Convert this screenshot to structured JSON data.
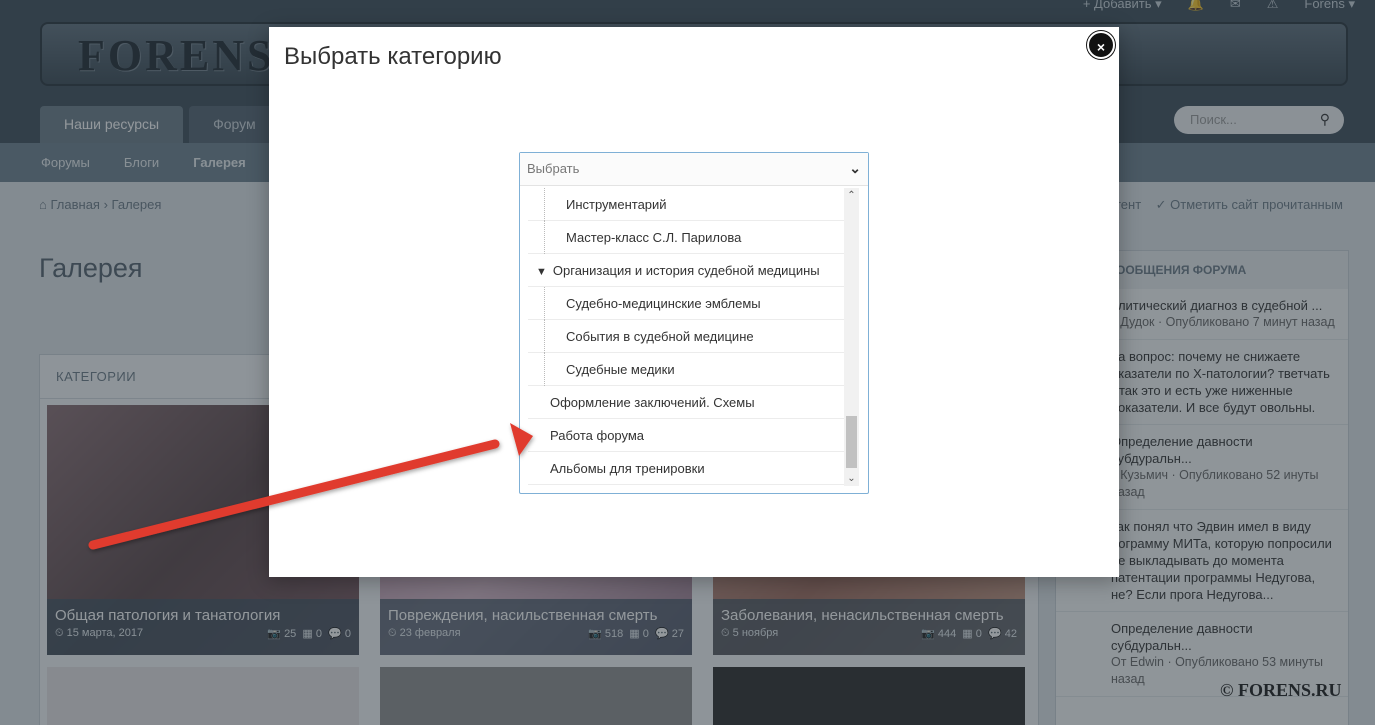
{
  "header": {
    "logo_text": "FORENS",
    "user_menu": [
      "+ Добавить ▾",
      "Forens ▾"
    ],
    "tabs": [
      "Наши ресурсы",
      "Форум"
    ],
    "search_placeholder": "Поиск..."
  },
  "subnav": [
    "Форумы",
    "Блоги",
    "Галерея"
  ],
  "breadcrumb": {
    "home": "Главная",
    "current": "Галерея"
  },
  "right_actions": {
    "content": "тент",
    "mark_read": "Отметить сайт прочитанным"
  },
  "page_title": "Галерея",
  "categories": {
    "heading": "КАТЕГОРИИ",
    "tiles": [
      {
        "name": "Общая патология и танатология",
        "date": "15 марта, 2017",
        "images": "25",
        "albums": "0",
        "comments": "0"
      },
      {
        "name": "Повреждения, насильственная смерть",
        "date": "23 февраля",
        "images": "518",
        "albums": "0",
        "comments": "27"
      },
      {
        "name": "Заболевания, ненасильственная смерть",
        "date": "5 ноября",
        "images": "444",
        "albums": "0",
        "comments": "42"
      }
    ]
  },
  "sidebar": {
    "heading": "ООБЩЕНИЯ ФОРУМА",
    "posts": [
      {
        "title": "олитический диагноз в судебной ...",
        "meta": "т Дудок · Опубликовано 7 минут назад"
      },
      {
        "title": "на вопрос: почему не снижаете оказатели по Х-патологии? тветчать - так это и есть уже ниженные показатели. И все будут овольны.",
        "meta": ""
      },
      {
        "title": "Определение давности субдуральн...",
        "meta": "т Кузьмич · Опубликовано 52 инуты назад"
      },
      {
        "title": "так понял что Эдвин имел в виду рограмму МИТа, которую попросили не выкладывать до момента патентации программы Недугова, не? Если прога Недугова...",
        "meta": ""
      },
      {
        "title": "Определение давности субдуральн...",
        "meta": "От Edwin · Опубликовано 53 минуты назад"
      }
    ]
  },
  "watermark": "© FORENS.RU",
  "modal": {
    "title": "Выбрать категорию",
    "close_label": "×",
    "select": {
      "placeholder": "Выбрать",
      "options": [
        {
          "label": "Инструментарий",
          "level": 2
        },
        {
          "label": "Мастер-класс С.Л. Парилова",
          "level": 2
        },
        {
          "label": "Организация и история судебной медицины",
          "level": 0,
          "expanded": true
        },
        {
          "label": "Судебно-медицинские эмблемы",
          "level": 2
        },
        {
          "label": "События в судебной медицине",
          "level": 2
        },
        {
          "label": "Судебные медики",
          "level": 2
        },
        {
          "label": "Оформление заключений. Схемы",
          "level": 1
        },
        {
          "label": "Работа форума",
          "level": 1
        },
        {
          "label": "Альбомы для тренировки",
          "level": 1
        }
      ]
    }
  },
  "annotation": {
    "type": "arrow",
    "color": "#e03b2e"
  }
}
